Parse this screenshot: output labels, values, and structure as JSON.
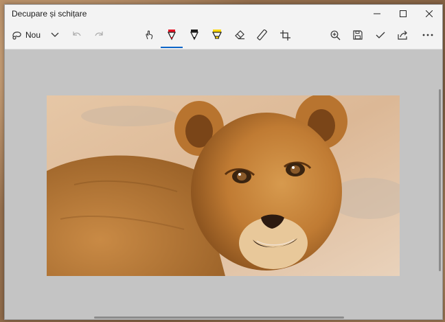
{
  "window": {
    "title": "Decupare și schițare"
  },
  "toolbar": {
    "new_label": "Nou"
  },
  "icons": {
    "new_snip": "snip-icon",
    "dropdown": "chevron-down-icon",
    "undo": "undo-icon",
    "redo": "redo-icon",
    "touch_write": "touch-writing-icon",
    "ballpoint": "ballpoint-pen-icon",
    "pencil": "pencil-icon",
    "highlighter": "highlighter-icon",
    "eraser": "eraser-icon",
    "ruler": "ruler-icon",
    "crop": "crop-icon",
    "zoom": "zoom-icon",
    "save": "save-icon",
    "copy": "check-icon",
    "share": "share-icon",
    "more": "more-icon"
  },
  "colors": {
    "ballpoint": "#e81123",
    "pencil": "#1a1a1a",
    "highlighter": "#ffd800",
    "accent": "#0a64c8"
  }
}
